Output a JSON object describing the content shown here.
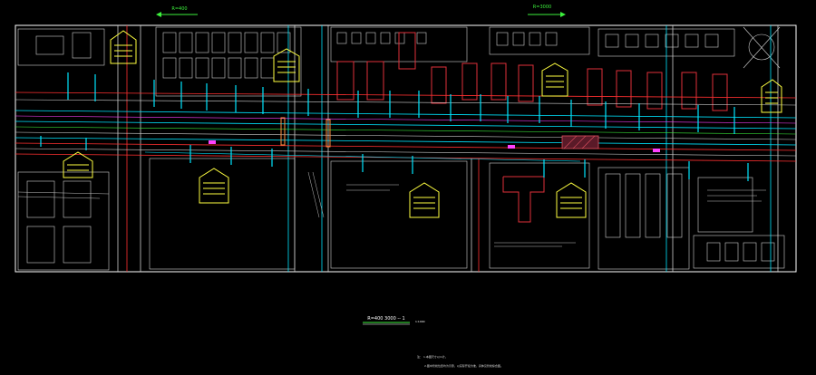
{
  "top_labels": [
    {
      "text": "R=400",
      "color": "#3cf03c"
    },
    {
      "text": "R=3000",
      "color": "#3cf03c"
    }
  ],
  "caption": {
    "title": "R=400 3000 -- 1",
    "scale": "1:1000"
  },
  "notes": [
    "注： 1.本图尺寸以m计。",
    "2.图中管线位置均为示意，以实际开挖为准，具体见管线综合图。"
  ],
  "colors": {
    "background": "#000000",
    "frame": "#ffffff",
    "road": "#ff3030",
    "pipe_cyan": "#00e5ff",
    "building_red": "#e0303a",
    "buildings_white": "#d8d8d8",
    "tag_yellow": "#ffff40",
    "magenta": "#ff40ff",
    "green": "#3cf03c",
    "orange": "#ff9040",
    "hatch": "#e05060"
  }
}
